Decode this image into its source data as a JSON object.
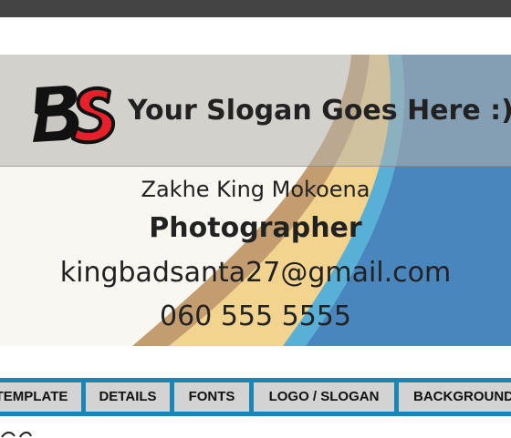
{
  "card": {
    "logo_text": "BS",
    "slogan": "Your Slogan Goes Here :)",
    "name": "Zakhe King Mokoena",
    "title": "Photographer",
    "email": "kingbadsanta27@gmail.com",
    "phone": "060 555 5555"
  },
  "tabs": [
    {
      "label": "TEMPLATE"
    },
    {
      "label": "DETAILS"
    },
    {
      "label": "FONTS"
    },
    {
      "label": "LOGO / SLOGAN"
    },
    {
      "label": "BACKGROUND"
    }
  ],
  "colors": {
    "topbar": "#444444",
    "tabbar": "#1a86b5",
    "tab_bg": "#d3d3d3",
    "wave_blue": "#4a86be",
    "wave_teal": "#59b0d6",
    "wave_gold": "#f2d48e",
    "wave_tan": "#c39c70"
  }
}
